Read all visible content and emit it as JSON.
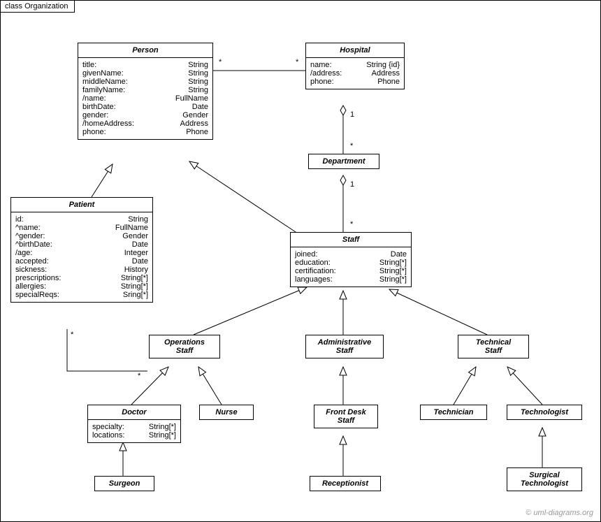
{
  "frame": {
    "label": "class Organization"
  },
  "watermark": "© uml-diagrams.org",
  "classes": {
    "person": {
      "name": "Person",
      "attrs": [
        [
          "title:",
          "String"
        ],
        [
          "givenName:",
          "String"
        ],
        [
          "middleName:",
          "String"
        ],
        [
          "familyName:",
          "String"
        ],
        [
          "/name:",
          "FullName"
        ],
        [
          "birthDate:",
          "Date"
        ],
        [
          "gender:",
          "Gender"
        ],
        [
          "/homeAddress:",
          "Address"
        ],
        [
          "phone:",
          "Phone"
        ]
      ]
    },
    "hospital": {
      "name": "Hospital",
      "attrs": [
        [
          "name:",
          "String {id}"
        ],
        [
          "/address:",
          "Address"
        ],
        [
          "phone:",
          "Phone"
        ]
      ]
    },
    "department": {
      "name": "Department"
    },
    "patient": {
      "name": "Patient",
      "attrs": [
        [
          "id:",
          "String"
        ],
        [
          "^name:",
          "FullName"
        ],
        [
          "^gender:",
          "Gender"
        ],
        [
          "^birthDate:",
          "Date"
        ],
        [
          "/age:",
          "Integer"
        ],
        [
          "accepted:",
          "Date"
        ],
        [
          "sickness:",
          "History"
        ],
        [
          "prescriptions:",
          "String[*]"
        ],
        [
          "allergies:",
          "String[*]"
        ],
        [
          "specialReqs:",
          "Sring[*]"
        ]
      ]
    },
    "staff": {
      "name": "Staff",
      "attrs": [
        [
          "joined:",
          "Date"
        ],
        [
          "education:",
          "String[*]"
        ],
        [
          "certification:",
          "String[*]"
        ],
        [
          "languages:",
          "String[*]"
        ]
      ]
    },
    "operations_staff": {
      "name": "Operations\nStaff"
    },
    "administrative_staff": {
      "name": "Administrative\nStaff"
    },
    "technical_staff": {
      "name": "Technical\nStaff"
    },
    "doctor": {
      "name": "Doctor",
      "attrs": [
        [
          "specialty:",
          "String[*]"
        ],
        [
          "locations:",
          "String[*]"
        ]
      ]
    },
    "nurse": {
      "name": "Nurse"
    },
    "front_desk_staff": {
      "name": "Front Desk\nStaff"
    },
    "technician": {
      "name": "Technician"
    },
    "technologist": {
      "name": "Technologist"
    },
    "surgeon": {
      "name": "Surgeon"
    },
    "receptionist": {
      "name": "Receptionist"
    },
    "surgical_technologist": {
      "name": "Surgical\nTechnologist"
    }
  },
  "multiplicities": {
    "person_hospital_left": "*",
    "person_hospital_right": "*",
    "hospital_dept_top": "1",
    "hospital_dept_bottom": "*",
    "dept_staff_top": "1",
    "dept_staff_bottom": "*",
    "patient_ops_left": "*",
    "patient_ops_right": "*"
  }
}
